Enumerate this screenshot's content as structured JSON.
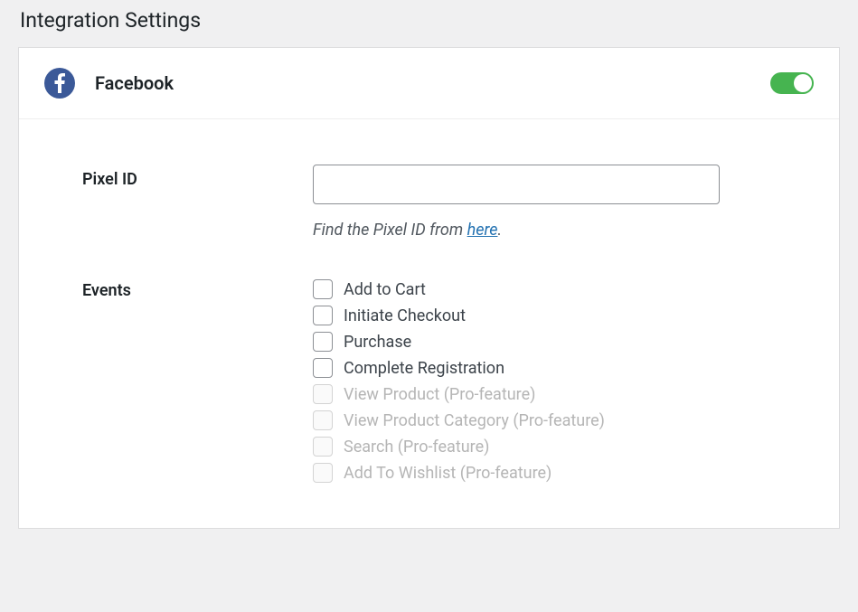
{
  "page": {
    "title": "Integration Settings"
  },
  "integration": {
    "name": "Facebook",
    "enabled": true,
    "icon": "facebook-icon"
  },
  "pixel": {
    "label": "Pixel ID",
    "value": "",
    "help_prefix": "Find the Pixel ID from ",
    "help_link_text": "here",
    "help_suffix": "."
  },
  "events": {
    "label": "Events",
    "items": [
      {
        "label": "Add to Cart",
        "checked": false,
        "disabled": false
      },
      {
        "label": "Initiate Checkout",
        "checked": false,
        "disabled": false
      },
      {
        "label": "Purchase",
        "checked": false,
        "disabled": false
      },
      {
        "label": "Complete Registration",
        "checked": false,
        "disabled": false
      },
      {
        "label": "View Product (Pro-feature)",
        "checked": false,
        "disabled": true
      },
      {
        "label": "View Product Category (Pro-feature)",
        "checked": false,
        "disabled": true
      },
      {
        "label": "Search (Pro-feature)",
        "checked": false,
        "disabled": true
      },
      {
        "label": "Add To Wishlist (Pro-feature)",
        "checked": false,
        "disabled": true
      }
    ]
  }
}
